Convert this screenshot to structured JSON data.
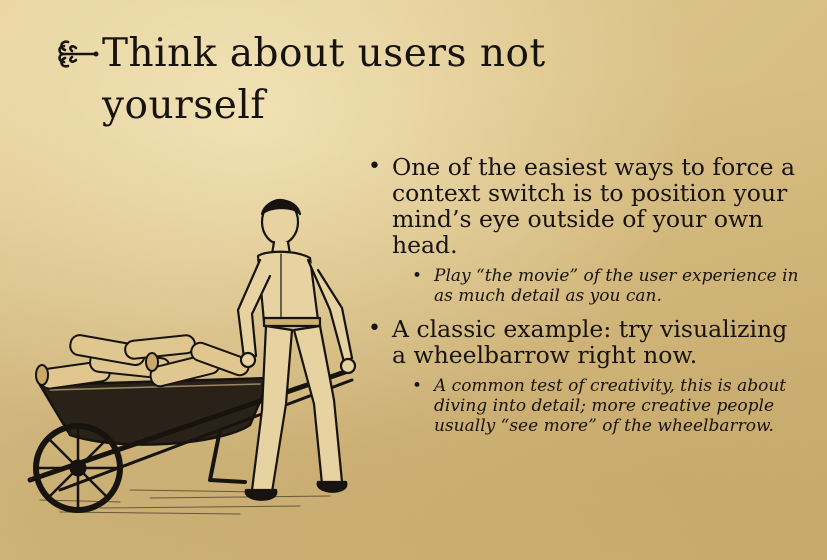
{
  "title": {
    "line1": "Think about users not",
    "line2": "yourself"
  },
  "ornament_icon": "fleuron-icon",
  "bullets": [
    {
      "text": "One of the easiest ways to force a context switch is to position your mind’s eye outside of your own head.",
      "sub": "Play “the movie” of the user experience in as much detail as you can."
    },
    {
      "text": "A classic example: try visualizing a wheelbarrow right now.",
      "sub": "A common test of creativity, this is about diving into detail; more creative people usually “see more” of the wheelbarrow."
    }
  ],
  "illustration": "man-pushing-wheelbarrow-of-logs",
  "colors": {
    "ink": "#17130e",
    "parchment": "#dcc48a"
  }
}
